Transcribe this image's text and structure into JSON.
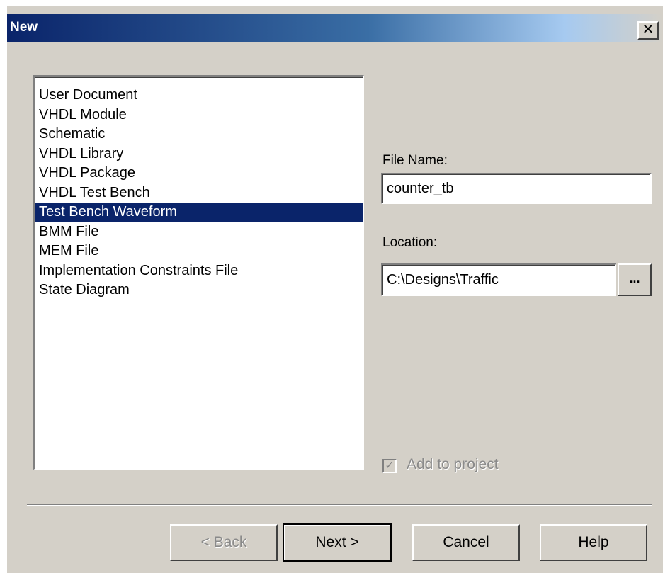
{
  "dialog": {
    "title": "New",
    "close_symbol": "✕"
  },
  "file_types": [
    {
      "label": "User Document",
      "selected": false
    },
    {
      "label": "VHDL Module",
      "selected": false
    },
    {
      "label": "Schematic",
      "selected": false
    },
    {
      "label": "VHDL Library",
      "selected": false
    },
    {
      "label": "VHDL Package",
      "selected": false
    },
    {
      "label": "VHDL Test Bench",
      "selected": false
    },
    {
      "label": "Test Bench Waveform",
      "selected": true
    },
    {
      "label": "BMM File",
      "selected": false
    },
    {
      "label": "MEM File",
      "selected": false
    },
    {
      "label": "Implementation Constraints File",
      "selected": false
    },
    {
      "label": "State Diagram",
      "selected": false
    }
  ],
  "file_name": {
    "label": "File Name:",
    "value": "counter_tb"
  },
  "location": {
    "label": "Location:",
    "value": "C:\\Designs\\Traffic",
    "browse_label": "..."
  },
  "add_to_project": {
    "label": "Add to project",
    "checked": true,
    "enabled": false
  },
  "buttons": {
    "back": "< Back",
    "next": "Next >",
    "cancel": "Cancel",
    "help": "Help"
  },
  "colors": {
    "dialog_bg": "#d4d0c8",
    "selection_bg": "#0a246a",
    "title_gradient_start": "#0a246a"
  }
}
